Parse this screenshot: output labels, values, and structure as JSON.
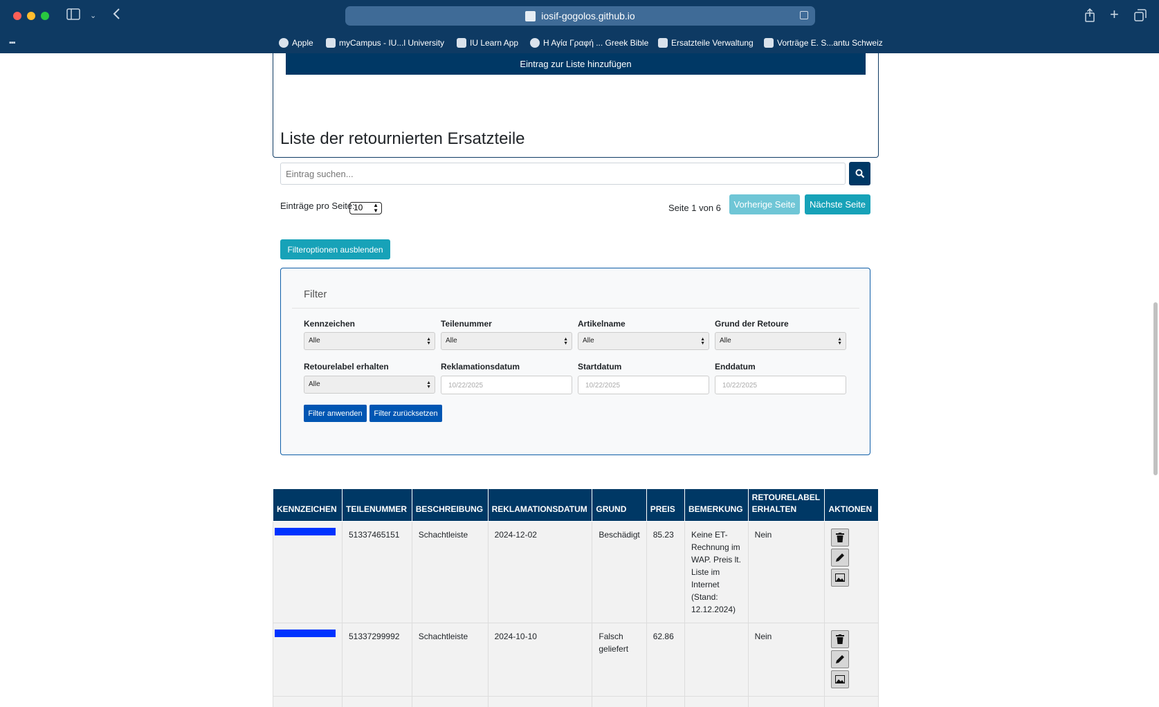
{
  "browser": {
    "url": "iosif-gogolos.github.io",
    "bookmarks": [
      "Apple",
      "myCampus - IU...l University",
      "IU Learn App",
      "Η Αγία Γραφή ... Greek Bible",
      "Ersatzteile Verwaltung",
      "Vorträge E. S...antu Schweiz"
    ]
  },
  "form": {
    "add_button": "Eintrag zur Liste hinzufügen"
  },
  "list": {
    "title": "Liste der retournierten Ersatzteile",
    "search_placeholder": "Eintrag suchen...",
    "per_page_label": "Einträge pro Seite:",
    "per_page_value": "10",
    "page_info": "Seite 1 von 6",
    "prev_label": "Vorherige Seite",
    "next_label": "Nächste Seite",
    "filter_toggle": "Filteroptionen ausblenden"
  },
  "filter": {
    "title": "Filter",
    "kennzeichen": {
      "label": "Kennzeichen",
      "value": "Alle"
    },
    "teilenummer": {
      "label": "Teilenummer",
      "value": "Alle"
    },
    "artikelname": {
      "label": "Artikelname",
      "value": "Alle"
    },
    "grund": {
      "label": "Grund der Retoure",
      "value": "Alle"
    },
    "retourelabel": {
      "label": "Retourelabel erhalten",
      "value": "Alle"
    },
    "reklamationsdatum": {
      "label": "Reklamationsdatum",
      "value": "10/22/2025"
    },
    "startdatum": {
      "label": "Startdatum",
      "value": "10/22/2025"
    },
    "enddatum": {
      "label": "Enddatum",
      "value": "10/22/2025"
    },
    "apply": "Filter anwenden",
    "reset": "Filter zurücksetzen"
  },
  "table": {
    "headers": [
      "KENNZEICHEN",
      "TEILENUMMER",
      "BESCHREIBUNG",
      "REKLAMATIONSDATUM",
      "GRUND",
      "PREIS",
      "BEMERKUNG",
      "RETOURELABEL ERHALTEN",
      "AKTIONEN"
    ],
    "rows": [
      {
        "teilenummer": "51337465151",
        "beschreibung": "Schachtleiste",
        "datum": "2024-12-02",
        "grund": "Beschädigt",
        "preis": "85.23",
        "bemerkung": "Keine ET-Rechnung im WAP. Preis lt. Liste im Internet (Stand: 12.12.2024)",
        "retourelabel": "Nein"
      },
      {
        "teilenummer": "51337299992",
        "beschreibung": "Schachtleiste",
        "datum": "2024-10-10",
        "grund": "Falsch geliefert",
        "preis": "62.86",
        "bemerkung": "",
        "retourelabel": "Nein"
      }
    ]
  },
  "icons": {
    "search": "search-icon",
    "delete": "trash-icon",
    "edit": "pencil-icon",
    "image": "image-icon"
  },
  "colors": {
    "navy": "#003865",
    "teal": "#17a2b8",
    "blue": "#0056b3"
  }
}
